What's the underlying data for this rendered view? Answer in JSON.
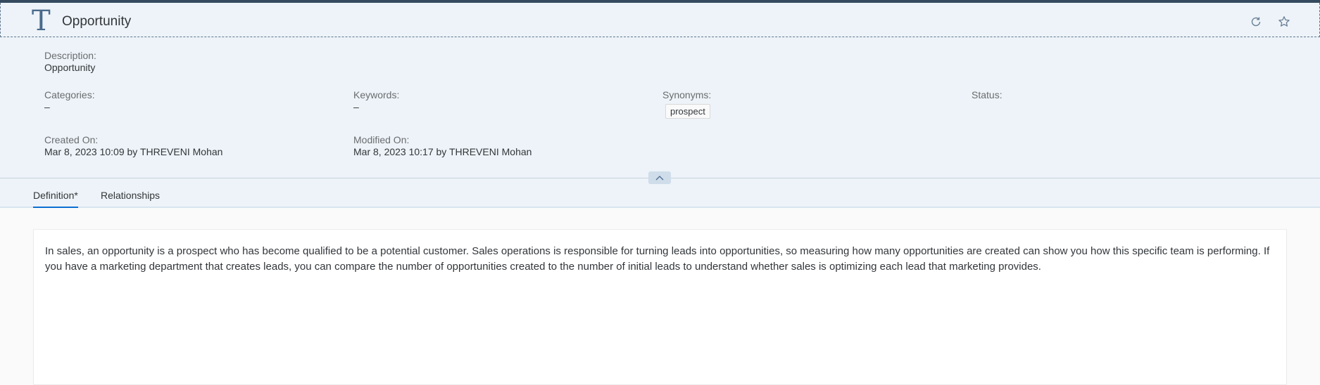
{
  "header": {
    "type_icon": "T",
    "title": "Opportunity",
    "refresh_icon": "refresh-icon",
    "favorite_icon": "star-icon"
  },
  "details": {
    "description": {
      "label": "Description:",
      "value": "Opportunity"
    },
    "categories": {
      "label": "Categories:",
      "value": "–"
    },
    "keywords": {
      "label": "Keywords:",
      "value": "–"
    },
    "synonyms": {
      "label": "Synonyms:",
      "tokens": [
        "prospect"
      ]
    },
    "status": {
      "label": "Status:",
      "value": ""
    },
    "created_on": {
      "label": "Created On:",
      "value": "Mar 8, 2023 10:09 by THREVENI Mohan"
    },
    "modified_on": {
      "label": "Modified On:",
      "value": "Mar 8, 2023 10:17 by THREVENI Mohan"
    }
  },
  "tabs": [
    {
      "label": "Definition*",
      "active": true
    },
    {
      "label": "Relationships",
      "active": false
    }
  ],
  "definition": {
    "text": "In sales, an opportunity is a prospect who has become qualified to be a potential customer. Sales operations is responsible for turning leads into opportunities, so measuring how many opportunities are created can show you how this specific team is performing. If you have a marketing department that creates leads, you can compare the number of opportunities created to the number of initial leads to understand whether sales is optimizing each lead that marketing provides."
  },
  "colors": {
    "header_bg": "#edf3f8",
    "accent": "#0a6ed1",
    "shell": "#354a5f"
  }
}
